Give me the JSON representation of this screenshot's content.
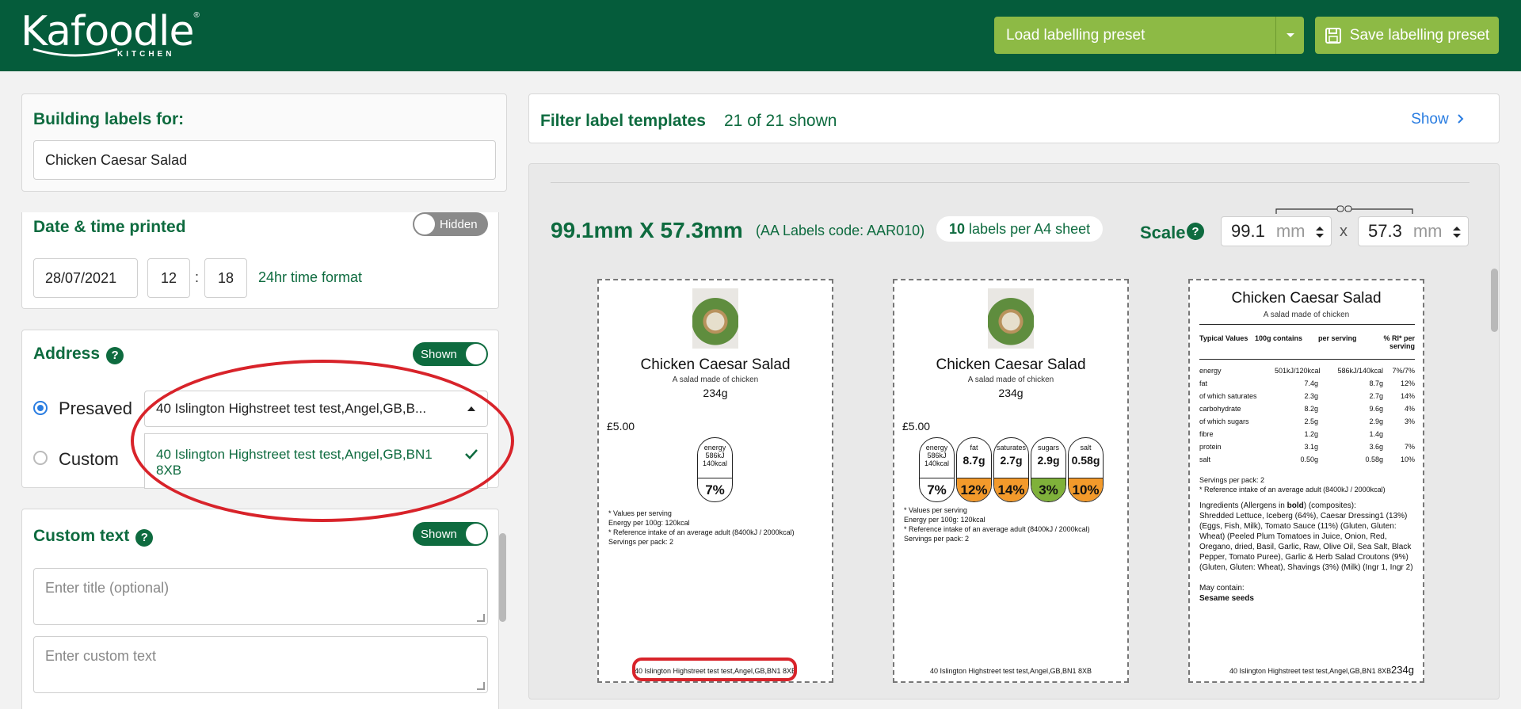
{
  "brand": {
    "logo_text": "Kafoodle",
    "logo_reg": "®",
    "logo_sub": "KITCHEN"
  },
  "header": {
    "load_preset": "Load labelling preset",
    "save_preset": "Save labelling preset"
  },
  "building": {
    "title": "Building labels for:",
    "value": "Chicken Caesar Salad"
  },
  "datetime": {
    "title": "Date & time printed",
    "toggle": "Hidden",
    "date": "28/07/2021",
    "hour": "12",
    "sep": ":",
    "minute": "18",
    "format": "24hr time format"
  },
  "address": {
    "title": "Address",
    "help": "?",
    "toggle": "Shown",
    "presaved_label": "Presaved",
    "custom_label": "Custom",
    "select_value": "40 Islington Highstreet test test,Angel,GB,B...",
    "option": "40 Islington Highstreet test test,Angel,GB,BN1 8XB"
  },
  "custom_text": {
    "title": "Custom text",
    "help": "?",
    "toggle": "Shown",
    "title_placeholder": "Enter title (optional)",
    "text_placeholder": "Enter custom text"
  },
  "filter": {
    "title": "Filter label templates",
    "count": "21 of 21 shown",
    "show": "Show"
  },
  "size": {
    "dims": "99.1mm X 57.3mm",
    "code": "(AA Labels code: AAR010)",
    "per_sheet_num": "10",
    "per_sheet_text": "labels per A4 sheet",
    "scale_label": "Scale",
    "help": "?",
    "w": "99.1",
    "h": "57.3",
    "unit": "mm",
    "times": "x"
  },
  "label": {
    "title": "Chicken Caesar Salad",
    "sub": "A salad made of chicken",
    "weight": "234g",
    "price": "£5.00",
    "notes": [
      "* Values per serving",
      "Energy per 100g: 120kcal",
      "* Reference intake of an average adult (8400kJ / 2000kcal)",
      "Servings per pack: 2"
    ],
    "address": "40 Islington Highstreet test test,Angel,GB,BN1 8XB",
    "energy": {
      "name": "energy",
      "kj": "586kJ",
      "kcal": "140kcal",
      "pct": "7%"
    },
    "traffic": [
      {
        "name": "fat",
        "value": "8.7g",
        "pct": "12%",
        "color": "#f39a2b"
      },
      {
        "name": "saturates",
        "value": "2.7g",
        "pct": "14%",
        "color": "#f39a2b"
      },
      {
        "name": "sugars",
        "value": "2.9g",
        "pct": "3%",
        "color": "#7fb13a"
      },
      {
        "name": "salt",
        "value": "0.58g",
        "pct": "10%",
        "color": "#f39a2b"
      }
    ]
  },
  "table": {
    "headers": [
      "Typical Values",
      "100g contains",
      "per serving",
      "% RI* per serving"
    ],
    "rows": [
      [
        "energy",
        "501kJ/120kcal",
        "586kJ/140kcal",
        "7%/7%"
      ],
      [
        "fat",
        "7.4g",
        "8.7g",
        "12%"
      ],
      [
        "of which saturates",
        "2.3g",
        "2.7g",
        "14%"
      ],
      [
        "carbohydrate",
        "8.2g",
        "9.6g",
        "4%"
      ],
      [
        "of which sugars",
        "2.5g",
        "2.9g",
        "3%"
      ],
      [
        "fibre",
        "1.2g",
        "1.4g",
        ""
      ],
      [
        "protein",
        "3.1g",
        "3.6g",
        "7%"
      ],
      [
        "salt",
        "0.50g",
        "0.58g",
        "10%"
      ]
    ],
    "servings": "Servings per pack: 2",
    "ri_note": "* Reference intake of an average adult (8400kJ / 2000kcal)",
    "ingredients_head": "Ingredients (Allergens in",
    "ingredients_bold": "bold",
    "ingredients_tail": ") (composites):",
    "ingredients_text": "Shredded Lettuce, Iceberg (64%), Caesar Dressing1 (13%) (Eggs, Fish, Milk), Tomato Sauce (11%) (Gluten, Gluten: Wheat) (Peeled Plum Tomatoes in Juice, Onion, Red, Oregano, dried, Basil, Garlic, Raw, Olive Oil, Sea Salt, Black Pepper, Tomato Puree), Garlic & Herb Salad Croutons (9%) (Gluten, Gluten: Wheat), Shavings (3%) (Milk) (Ingr 1, Ingr 2)",
    "may_contain": "May contain:",
    "may_contain_value": "Sesame seeds"
  },
  "colors": {
    "header": "#055c3b",
    "brand_green": "#0e6b3f",
    "button_green": "#8dba45",
    "annotation_red": "#d8232a",
    "amber": "#f39a2b",
    "light_green": "#7fb13a"
  }
}
